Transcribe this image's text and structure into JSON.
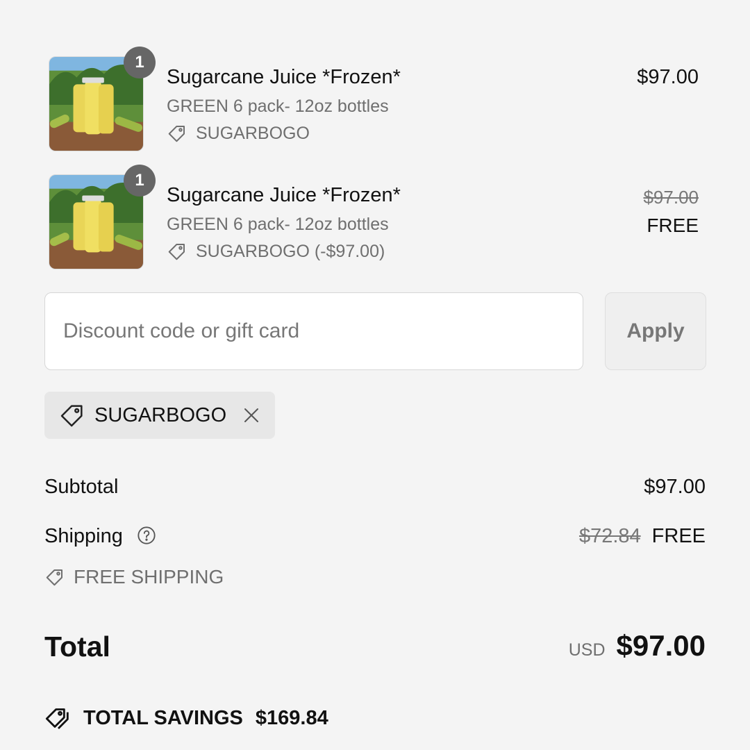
{
  "items": [
    {
      "quantity": "1",
      "title": "Sugarcane Juice *Frozen*",
      "variant": "GREEN 6 pack- 12oz bottles",
      "discount_label": "SUGARBOGO",
      "price": "$97.00",
      "original_price": "",
      "final_price": ""
    },
    {
      "quantity": "1",
      "title": "Sugarcane Juice *Frozen*",
      "variant": "GREEN 6 pack- 12oz bottles",
      "discount_label": "SUGARBOGO (-$97.00)",
      "price": "",
      "original_price": "$97.00",
      "final_price": "FREE"
    }
  ],
  "discount_form": {
    "placeholder": "Discount code or gift card",
    "apply_label": "Apply"
  },
  "applied_code": {
    "label": "SUGARBOGO"
  },
  "summary": {
    "subtotal_label": "Subtotal",
    "subtotal_value": "$97.00",
    "shipping_label": "Shipping",
    "shipping_original": "$72.84",
    "shipping_value": "FREE",
    "shipping_discount": "FREE SHIPPING",
    "total_label": "Total",
    "currency": "USD",
    "total_value": "$97.00",
    "savings_label": "TOTAL SAVINGS",
    "savings_value": "$169.84"
  },
  "icons": {
    "tag": "tag-icon",
    "remove": "close-icon",
    "help": "question-circle-icon",
    "savings": "double-tag-icon"
  }
}
